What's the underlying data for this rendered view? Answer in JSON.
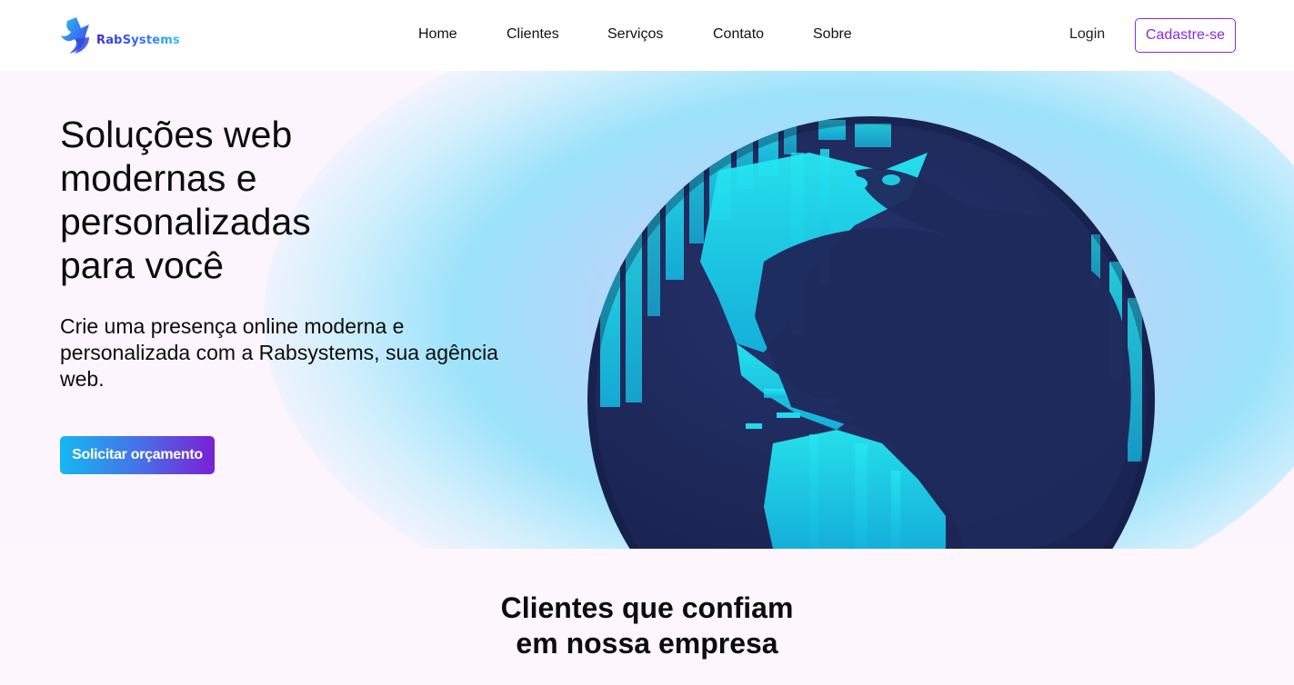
{
  "brand": {
    "name": "RabSystems",
    "logo_icon": "fox-logo-icon"
  },
  "nav": {
    "items": [
      {
        "label": "Home"
      },
      {
        "label": "Clientes"
      },
      {
        "label": "Serviços"
      },
      {
        "label": "Contato"
      },
      {
        "label": "Sobre"
      }
    ],
    "login_label": "Login",
    "signup_label": "Cadastre-se"
  },
  "hero": {
    "title_lines": [
      "Soluções web",
      "modernas e",
      "personalizadas",
      "para você"
    ],
    "subtitle": "Crie uma presença online moderna e personalizada com a Rabsystems, sua agência web.",
    "cta_label": "Solicitar orçamento",
    "image_icon": "globe-illustration"
  },
  "clients": {
    "title_lines": [
      "Clientes que confiam",
      "em nossa empresa"
    ]
  },
  "colors": {
    "accent_purple": "#8a2be2",
    "cta_gradient_start": "#14b8f0",
    "cta_gradient_end": "#7b1fd6",
    "globe_ocean": "#1f2a5c",
    "globe_land": "#1de3f0",
    "page_background": "#fdf5fd"
  }
}
